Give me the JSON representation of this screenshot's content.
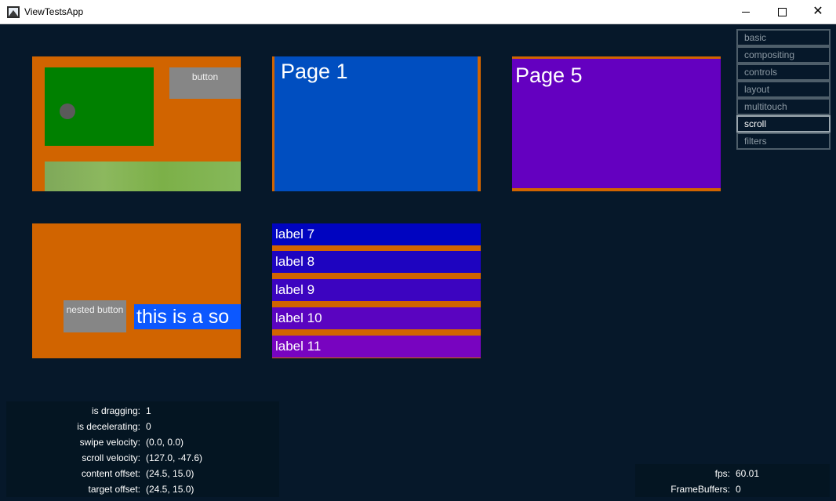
{
  "window": {
    "title": "ViewTestsApp",
    "controls": {
      "minimize": "minimize",
      "maximize": "maximize",
      "close": "✕"
    }
  },
  "menu": {
    "items": [
      {
        "label": "basic",
        "active": false
      },
      {
        "label": "compositing",
        "active": false
      },
      {
        "label": "controls",
        "active": false
      },
      {
        "label": "layout",
        "active": false
      },
      {
        "label": "multitouch",
        "active": false
      },
      {
        "label": "scroll",
        "active": true
      },
      {
        "label": "filters",
        "active": false
      }
    ]
  },
  "panels": {
    "basic_view": {
      "button_label": "button"
    },
    "pager_a": {
      "page_label": "Page 1"
    },
    "pager_b": {
      "page_label": "Page 5"
    },
    "nested": {
      "button_label": "nested button",
      "long_text": "this is a so"
    },
    "list": {
      "rows": [
        {
          "label": "label 7",
          "color": "#0004c0"
        },
        {
          "label": "label 8",
          "color": "#1e04c0"
        },
        {
          "label": "label 9",
          "color": "#3c04c0"
        },
        {
          "label": "label 10",
          "color": "#5a04c0"
        },
        {
          "label": "label 11",
          "color": "#7804c0"
        }
      ]
    }
  },
  "stats": [
    {
      "label": "is dragging:",
      "value": "1"
    },
    {
      "label": "is decelerating:",
      "value": "0"
    },
    {
      "label": "swipe velocity:",
      "value": "(0.0, 0.0)"
    },
    {
      "label": "scroll velocity:",
      "value": "(127.0, -47.6)"
    },
    {
      "label": "content offset:",
      "value": "(24.5, 15.0)"
    },
    {
      "label": "target offset:",
      "value": "(24.5, 15.0)"
    }
  ],
  "perf": [
    {
      "label": "fps:",
      "value": "60.01"
    },
    {
      "label": "FrameBuffers:",
      "value": "0"
    }
  ],
  "colors": {
    "background": "#06182a",
    "panel_orange": "#d16400",
    "green": "#008000",
    "page1_blue": "#004ec0",
    "page5_purple": "#6400c0",
    "text_blue": "#0c58ff"
  }
}
